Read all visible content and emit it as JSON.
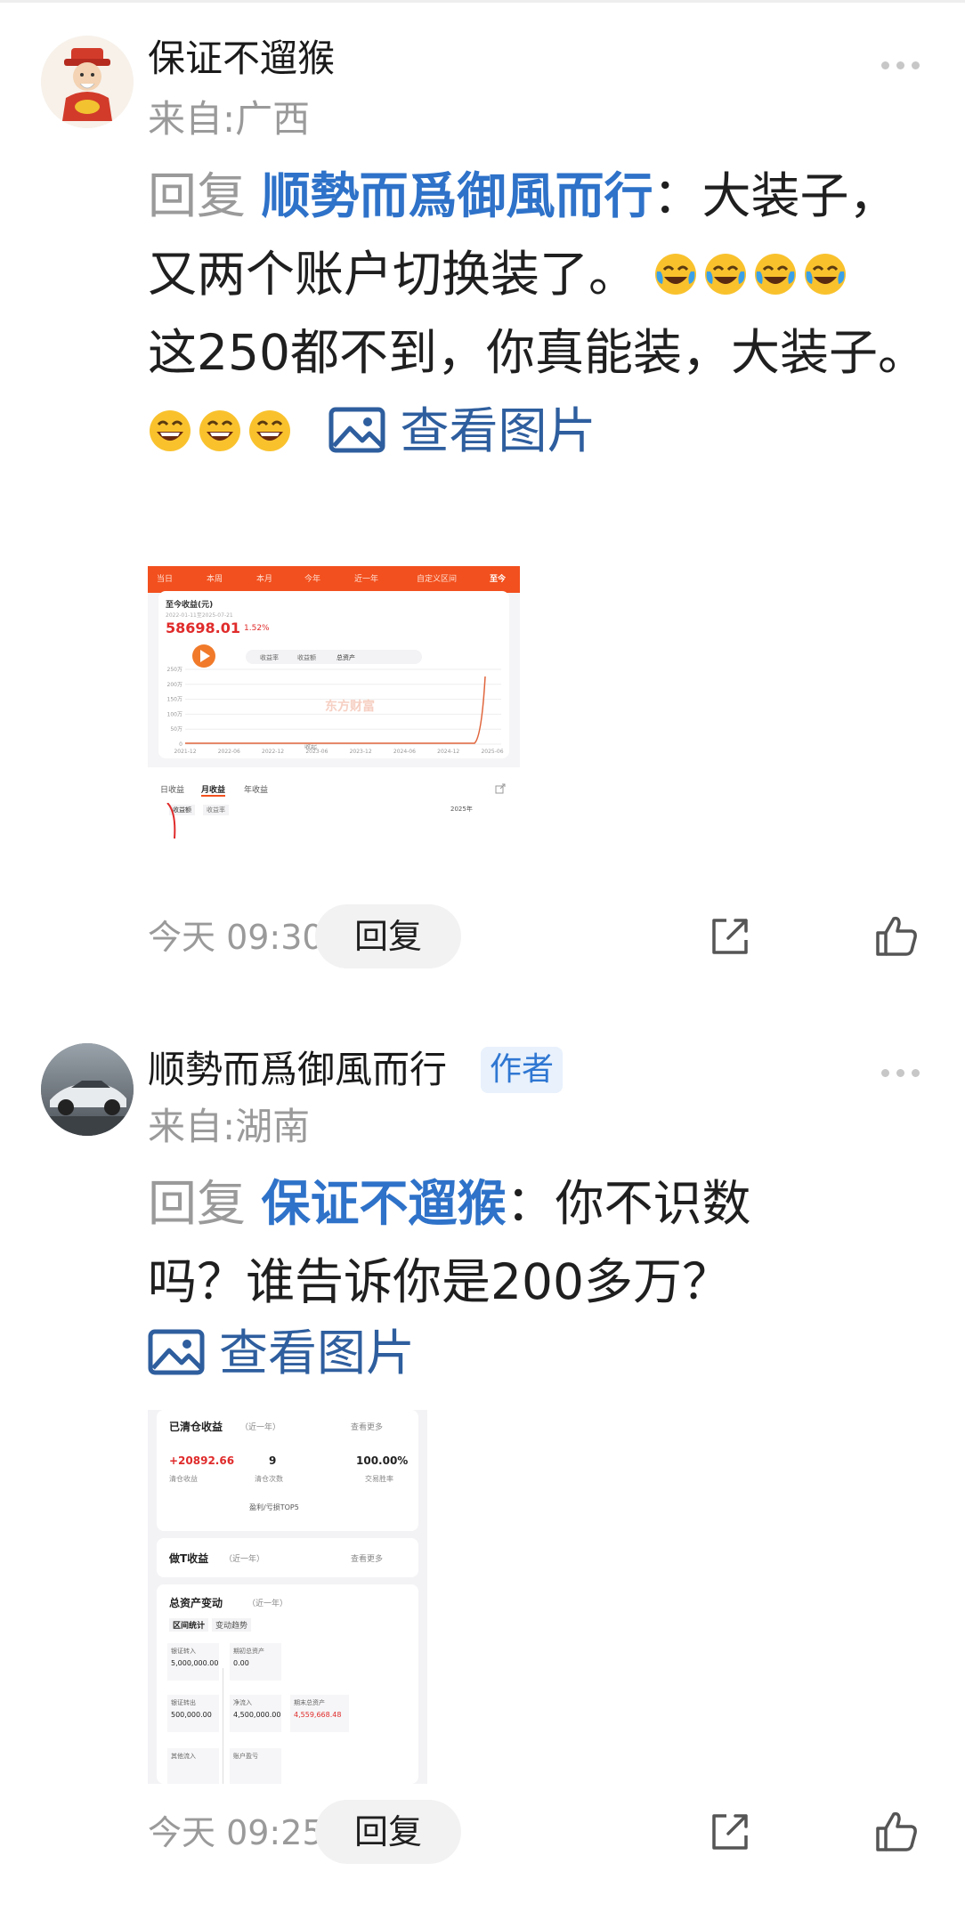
{
  "comments": [
    {
      "username": "保证不遛猴",
      "location": "来自:广西",
      "reply_prefix": "回复",
      "mention": "顺勢而爲御風而行",
      "text1": "：大装子，又两个账户切换装了。",
      "text2": "这250都不到，你真能装，大装子。",
      "view_pic": "查看图片",
      "time": "今天 09:30",
      "reply_btn": "回复",
      "emoji1": "crying-laughing-emoji",
      "emoji2": "grinning-emoji",
      "thumb": {
        "tabs": [
          "当日",
          "本周",
          "本月",
          "今年",
          "近一年",
          "自定义区间",
          "至今"
        ],
        "label": "至今收益(元)",
        "date_range": "2022-01-11至2025-07-21",
        "amount": "58698.01",
        "pct": "1.52%",
        "toggle": [
          "收益率",
          "收益额",
          "总资产"
        ],
        "y_ticks": [
          "250万",
          "200万",
          "150万",
          "100万",
          "50万",
          "0"
        ],
        "x_ticks": [
          "2021-12",
          "2022-06",
          "2022-12",
          "2023-06",
          "2023-12",
          "2024-06",
          "2024-12",
          "2025-06"
        ],
        "watermark": "东方财富",
        "collapse": "收起",
        "bottom_tabs": [
          "日收益",
          "月收益",
          "年收益"
        ],
        "sub_tabs": [
          "收益额",
          "收益率"
        ],
        "year": "2025年"
      }
    },
    {
      "username": "顺勢而爲御風而行",
      "badge": "作者",
      "location": "来自:湖南",
      "reply_prefix": "回复",
      "mention": "保证不遛猴",
      "text1": "：你不识数吗？谁告诉你是200多万？",
      "view_pic": "查看图片",
      "time": "今天 09:25",
      "reply_btn": "回复",
      "thumb": {
        "sec1_title": "已清仓收益",
        "sec1_period": "（近一年）",
        "more": "查看更多",
        "profit": "+20892.66",
        "profit_label": "清仓收益",
        "count": "9",
        "count_label": "清仓次数",
        "rate": "100.00%",
        "rate_label": "交易胜率",
        "top5": "盈利/亏损TOP5",
        "sec2_title": "做T收益",
        "sec2_period": "（近一年）",
        "sec3_title": "总资产变动",
        "sec3_period": "（近一年）",
        "sec3_tabs": [
          "区间统计",
          "变动趋势"
        ],
        "transfer_in_label": "银证转入",
        "transfer_in": "5,000,000.00",
        "begin_label": "期初总资产",
        "begin": "0.00",
        "transfer_out_label": "银证转出",
        "transfer_out": "500,000.00",
        "net_label": "净流入",
        "net": "4,500,000.00",
        "end_label": "期末总资产",
        "end": "4,559,668.48",
        "other_in_label": "其他流入",
        "pnl_label": "账户盈亏"
      }
    }
  ],
  "colors": {
    "mention": "#2e72c9",
    "muted": "#9a9a9a",
    "brand_orange": "#f2501e",
    "profit_red": "#e02b2b"
  }
}
